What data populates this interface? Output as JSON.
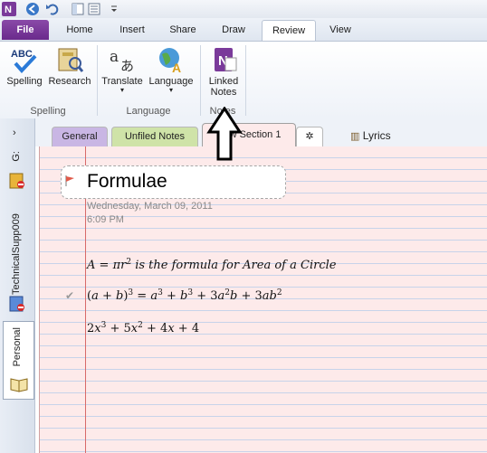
{
  "ribbon_tabs": {
    "file": "File",
    "home": "Home",
    "insert": "Insert",
    "share": "Share",
    "draw": "Draw",
    "review": "Review",
    "view": "View"
  },
  "ribbon": {
    "spelling": "Spelling",
    "research": "Research",
    "translate": "Translate",
    "language": "Language",
    "linked_notes_1": "Linked",
    "linked_notes_2": "Notes",
    "group_spelling": "Spelling",
    "group_language": "Language",
    "group_notes": "Notes"
  },
  "navbar": {
    "notebook_g": "G:",
    "notebook_tech": "TechnicalSupp009",
    "notebook_personal": "Personal"
  },
  "sections": {
    "general": "General",
    "unfiled": "Unfiled Notes",
    "new_section": "New Section 1",
    "lyrics": "Lyrics"
  },
  "page": {
    "title": "Formulae",
    "date": "Wednesday, March 09, 2011",
    "time": "6:09 PM"
  },
  "colors": {
    "file_tab": "#7a3a9a",
    "general_tab": "#c9b6e4",
    "unfiled_tab": "#cfe3a8",
    "page_bg": "#fdeaea",
    "margin_line": "#d86a6a"
  }
}
